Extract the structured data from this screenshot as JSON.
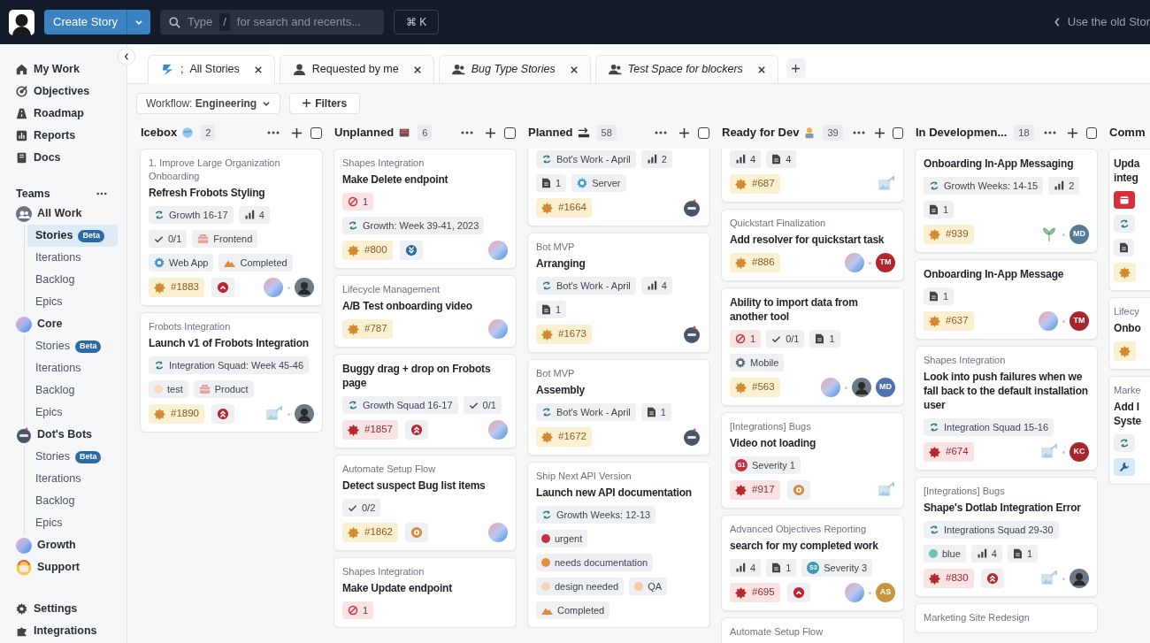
{
  "topbar": {
    "create_button": "Create Story",
    "search": {
      "placeholder_before": "Type",
      "key": "/",
      "placeholder_after": "for search and recents..."
    },
    "shortcut": "⌘ K",
    "old_view_link": "Use the old Stor"
  },
  "sidebar": {
    "nav": [
      {
        "label": "My Work"
      },
      {
        "label": "Objectives"
      },
      {
        "label": "Roadmap"
      },
      {
        "label": "Reports"
      },
      {
        "label": "Docs"
      }
    ],
    "teams_heading": "Teams",
    "teams": [
      {
        "label": "All Work",
        "children": [
          {
            "label": "Stories",
            "badge": "Beta",
            "selected": true
          },
          {
            "label": "Iterations",
            "selected": false
          },
          {
            "label": "Backlog",
            "selected": false
          },
          {
            "label": "Epics",
            "selected": false
          }
        ]
      },
      {
        "label": "Core",
        "children": [
          {
            "label": "Stories",
            "badge": "Beta",
            "selected": false
          },
          {
            "label": "Iterations",
            "selected": false
          },
          {
            "label": "Backlog",
            "selected": false
          },
          {
            "label": "Epics",
            "selected": false
          }
        ]
      },
      {
        "label": "Dot's Bots",
        "children": [
          {
            "label": "Stories",
            "badge": "Beta",
            "selected": false
          },
          {
            "label": "Iterations",
            "selected": false
          },
          {
            "label": "Backlog",
            "selected": false
          },
          {
            "label": "Epics",
            "selected": false
          }
        ]
      },
      {
        "label": "Growth"
      },
      {
        "label": "Support"
      }
    ],
    "footer": [
      {
        "label": "Settings"
      },
      {
        "label": "Integrations"
      }
    ]
  },
  "tabs": [
    {
      "prefix": ";",
      "label": "All Stories",
      "italic": false,
      "selected": true
    },
    {
      "label": "Requested by me",
      "italic": false,
      "selected": false
    },
    {
      "label": "Bug Type Stories",
      "italic": true,
      "selected": false
    },
    {
      "label": "Test Space for blockers",
      "italic": true,
      "selected": false
    }
  ],
  "filters": {
    "workflow": "Workflow: **Engineering**",
    "filters_button": "Filters"
  },
  "columns": [
    {
      "kind": "full",
      "title": "Icebox",
      "count": "2",
      "checked": false,
      "cards": [
        {
          "kind": "story",
          "epic": "1. Improve Large Organization Onboarding",
          "title": "Refresh Frobots Styling",
          "tag_rows": [
            {
              "tags": [
                {
                  "kind": "iteration",
                  "text": "Growth 16-17"
                },
                {
                  "kind": "estimate",
                  "text": "4"
                }
              ]
            },
            {
              "tags": [
                {
                  "kind": "tasks",
                  "text": "0/1"
                },
                {
                  "kind": "group",
                  "text": "Frontend"
                }
              ]
            },
            {
              "tags": [
                {
                  "kind": "area",
                  "text": "Web App",
                  "color": "#3b8fd6"
                },
                {
                  "kind": "skill",
                  "text": "Completed"
                }
              ]
            }
          ],
          "id": {
            "kind": "feature",
            "text": "#1883"
          },
          "priority": {
            "kind": "high"
          },
          "owners": [
            {
              "kind": "gradient"
            },
            {
              "kind": "person"
            }
          ]
        },
        {
          "kind": "story",
          "epic": "Frobots Integration",
          "title": "Launch v1 of Frobots Integration",
          "tag_rows": [
            {
              "tags": [
                {
                  "kind": "iteration",
                  "text": "Integration Squad: Week 45-46"
                }
              ]
            },
            {
              "tags": [
                {
                  "kind": "label",
                  "text": "test",
                  "color": "#f8d9bf"
                },
                {
                  "kind": "group",
                  "text": "Product"
                }
              ]
            }
          ],
          "id": {
            "kind": "feature",
            "text": "#1890"
          },
          "priority": {
            "kind": "highest"
          },
          "owners": [
            {
              "kind": "placeholder"
            },
            {
              "kind": "person"
            }
          ]
        }
      ]
    },
    {
      "kind": "full",
      "title": "Unplanned",
      "count": "6",
      "checked": false,
      "cards": [
        {
          "kind": "story",
          "epic": "Shapes Integration",
          "title": "Make Delete endpoint",
          "tag_rows": [
            {
              "tags": [
                {
                  "kind": "blocker",
                  "text": "1"
                }
              ]
            },
            {
              "tags": [
                {
                  "kind": "iteration",
                  "text": "Growth: Week 39-41, 2023"
                }
              ]
            }
          ],
          "id": {
            "kind": "feature",
            "text": "#800"
          },
          "priority": {
            "kind": "low"
          },
          "owners": [
            {
              "kind": "gradient"
            }
          ]
        },
        {
          "kind": "story",
          "epic": "Lifecycle Management",
          "title": "A/B Test onboarding video",
          "id": {
            "kind": "feature",
            "text": "#787"
          },
          "owners": [
            {
              "kind": "gradient"
            }
          ]
        },
        {
          "kind": "story",
          "title": "Buggy drag + drop on Frobots page",
          "tag_rows": [
            {
              "tags": [
                {
                  "kind": "iteration",
                  "text": "Growth Squad 16-17"
                },
                {
                  "kind": "tasks",
                  "text": "0/1"
                }
              ]
            }
          ],
          "id": {
            "kind": "bug",
            "text": "#1857"
          },
          "priority": {
            "kind": "highest"
          },
          "owners": [
            {
              "kind": "gradient"
            }
          ]
        },
        {
          "kind": "story",
          "epic": "Automate Setup Flow",
          "title": "Detect suspect Bug list items",
          "tag_rows": [
            {
              "tags": [
                {
                  "kind": "tasks",
                  "text": "0/2"
                }
              ]
            }
          ],
          "id": {
            "kind": "feature",
            "text": "#1862"
          },
          "priority": {
            "kind": "medium"
          },
          "owners": [
            {
              "kind": "gradient"
            }
          ]
        },
        {
          "kind": "story",
          "epic": "Shapes Integration",
          "title": "Make Update endpoint",
          "tag_rows": [
            {
              "tags": [
                {
                  "kind": "blocker",
                  "text": "1"
                }
              ]
            }
          ]
        }
      ]
    },
    {
      "kind": "full",
      "title": "Planned",
      "count": "58",
      "checked": false,
      "cards": [
        {
          "kind": "cut",
          "tag_rows": [
            {
              "tags": [
                {
                  "kind": "iteration",
                  "text": "Bot's Work - April"
                },
                {
                  "kind": "estimate",
                  "text": "2"
                }
              ]
            },
            {
              "tags": [
                {
                  "kind": "docs",
                  "text": "1"
                },
                {
                  "kind": "area",
                  "text": "Server",
                  "color": "#3b9fd6"
                }
              ]
            }
          ],
          "id": {
            "kind": "feature",
            "text": "#1664"
          },
          "owners": [
            {
              "kind": "bot"
            }
          ]
        },
        {
          "kind": "story",
          "epic": "Bot MVP",
          "title": "Arranging",
          "tag_rows": [
            {
              "tags": [
                {
                  "kind": "iteration",
                  "text": "Bot's Work - April"
                },
                {
                  "kind": "estimate",
                  "text": "4"
                }
              ]
            },
            {
              "tags": [
                {
                  "kind": "docs",
                  "text": "1"
                }
              ]
            }
          ],
          "id": {
            "kind": "feature",
            "text": "#1673"
          },
          "owners": [
            {
              "kind": "bot"
            }
          ]
        },
        {
          "kind": "story",
          "epic": "Bot MVP",
          "title": "Assembly",
          "tag_rows": [
            {
              "tags": [
                {
                  "kind": "iteration",
                  "text": "Bot's Work - April"
                },
                {
                  "kind": "docs",
                  "text": "1"
                }
              ]
            }
          ],
          "id": {
            "kind": "feature",
            "text": "#1672"
          },
          "owners": [
            {
              "kind": "bot"
            }
          ]
        },
        {
          "kind": "story",
          "epic": "Ship Next API Version",
          "title": "Launch new API documentation",
          "tag_rows": [
            {
              "tags": [
                {
                  "kind": "iteration",
                  "text": "Growth Weeks: 12-13"
                }
              ]
            },
            {
              "tags": [
                {
                  "kind": "label",
                  "text": "urgent",
                  "color": "#c0323f"
                }
              ]
            },
            {
              "tags": [
                {
                  "kind": "label",
                  "text": "needs documentation",
                  "color": "#e3913f"
                }
              ]
            },
            {
              "tags": [
                {
                  "kind": "label",
                  "text": "design needed",
                  "color": "#f6d3b0"
                },
                {
                  "kind": "label",
                  "text": "QA",
                  "color": "#f6c9a2"
                }
              ]
            },
            {
              "tags": [
                {
                  "kind": "skill",
                  "text": "Completed"
                }
              ]
            }
          ]
        }
      ]
    },
    {
      "kind": "full",
      "title": "Ready for Dev",
      "count": "39",
      "checked": false,
      "cards": [
        {
          "kind": "cut",
          "tag_rows": [
            {
              "tags": [
                {
                  "kind": "estimate",
                  "text": "4"
                },
                {
                  "kind": "docs",
                  "text": "4"
                }
              ]
            }
          ],
          "id": {
            "kind": "feature",
            "text": "#687"
          },
          "owners": [
            {
              "kind": "placeholder"
            }
          ]
        },
        {
          "kind": "story",
          "epic": "Quickstart Finalization",
          "title": "Add resolver for quickstart task",
          "id": {
            "kind": "feature",
            "text": "#886"
          },
          "owners": [
            {
              "kind": "gradient"
            },
            {
              "kind": "initials",
              "text": "TM",
              "color": "#b3262e"
            }
          ]
        },
        {
          "kind": "story",
          "title": "Ability to import data from another tool",
          "tag_rows": [
            {
              "tags": [
                {
                  "kind": "blocker",
                  "text": "1"
                },
                {
                  "kind": "tasks",
                  "text": "0/1"
                },
                {
                  "kind": "docs",
                  "text": "1"
                }
              ]
            },
            {
              "tags": [
                {
                  "kind": "area",
                  "text": "Mobile",
                  "color": "#5a6b7b"
                }
              ]
            }
          ],
          "id": {
            "kind": "feature",
            "text": "#563"
          },
          "owners": [
            {
              "kind": "gradient"
            },
            {
              "kind": "person"
            },
            {
              "kind": "initials",
              "text": "MD",
              "color": "#4f72ad"
            }
          ]
        },
        {
          "kind": "story",
          "epic": "[Integrations] Bugs",
          "title": "Video not loading",
          "tag_rows": [
            {
              "tags": [
                {
                  "kind": "severity",
                  "badge": "S1",
                  "text": "Severity 1",
                  "color": "#c0323f"
                }
              ]
            }
          ],
          "id": {
            "kind": "bug",
            "text": "#917"
          },
          "priority": {
            "kind": "medium"
          },
          "owners": [
            {
              "kind": "placeholder"
            }
          ]
        },
        {
          "kind": "story",
          "epic": "Advanced Objectives Reporting",
          "title": "search for my completed work",
          "tag_rows": [
            {
              "tags": [
                {
                  "kind": "estimate",
                  "text": "4"
                },
                {
                  "kind": "docs",
                  "text": "1"
                },
                {
                  "kind": "severity",
                  "badge": "S3",
                  "text": "Severity 3",
                  "color": "#3a9bb5"
                }
              ]
            }
          ],
          "id": {
            "kind": "bug",
            "text": "#695"
          },
          "priority": {
            "kind": "high"
          },
          "owners": [
            {
              "kind": "gradient"
            },
            {
              "kind": "initials",
              "text": "AS",
              "color": "#c9953f"
            }
          ]
        },
        {
          "kind": "story",
          "epic": "Automate Setup Flow"
        }
      ]
    },
    {
      "kind": "full",
      "title": "In Developmen...",
      "count": "18",
      "checked": false,
      "cards": [
        {
          "kind": "story",
          "title": "Onboarding In-App Messaging",
          "tag_rows": [
            {
              "tags": [
                {
                  "kind": "iteration",
                  "text": "Growth Weeks: 14-15"
                },
                {
                  "kind": "estimate",
                  "text": "2"
                }
              ]
            },
            {
              "tags": [
                {
                  "kind": "docs",
                  "text": "1"
                }
              ]
            }
          ],
          "id": {
            "kind": "feature",
            "text": "#939"
          },
          "owners": [
            {
              "kind": "plant"
            },
            {
              "kind": "initials",
              "text": "MD",
              "color": "#557a95"
            }
          ]
        },
        {
          "kind": "story",
          "title": "Onboarding In-App Message",
          "tag_rows": [
            {
              "tags": [
                {
                  "kind": "docs",
                  "text": "1"
                }
              ]
            }
          ],
          "id": {
            "kind": "feature",
            "text": "#637"
          },
          "owners": [
            {
              "kind": "gradient"
            },
            {
              "kind": "initials",
              "text": "TM",
              "color": "#a8262b"
            }
          ]
        },
        {
          "kind": "story",
          "epic": "Shapes Integration",
          "title": "Look into push failures when we fall back to the default installation user",
          "tag_rows": [
            {
              "tags": [
                {
                  "kind": "iteration",
                  "text": "Integration Squad 15-16"
                }
              ]
            }
          ],
          "id": {
            "kind": "bug",
            "text": "#674"
          },
          "owners": [
            {
              "kind": "placeholder"
            },
            {
              "kind": "initials",
              "text": "KC",
              "color": "#a8262b"
            }
          ]
        },
        {
          "kind": "story",
          "epic": "[Integrations] Bugs",
          "title": "Shape's Dotlab Integration Error",
          "tag_rows": [
            {
              "tags": [
                {
                  "kind": "iteration",
                  "text": "Integrations Squad 29-30"
                }
              ]
            },
            {
              "tags": [
                {
                  "kind": "label",
                  "text": "blue",
                  "color": "#6fc2b4"
                },
                {
                  "kind": "estimate",
                  "text": "4"
                },
                {
                  "kind": "docs",
                  "text": "1"
                }
              ]
            }
          ],
          "id": {
            "kind": "bug",
            "text": "#830"
          },
          "priority": {
            "kind": "highest"
          },
          "owners": [
            {
              "kind": "placeholder"
            },
            {
              "kind": "person"
            }
          ]
        },
        {
          "kind": "story",
          "epic": "Marketing Site Redesign"
        }
      ]
    },
    {
      "kind": "partial",
      "title": "Comm",
      "cards": [
        {
          "kind": "story",
          "title": "Upda integ",
          "tag_rows": [
            {
              "tags": [
                {
                  "kind": "deadline"
                }
              ]
            },
            {
              "tags": [
                {
                  "kind": "iteration"
                }
              ]
            },
            {
              "tags": [
                {
                  "kind": "docs"
                }
              ]
            }
          ],
          "id": {
            "kind": "feature"
          }
        },
        {
          "kind": "story",
          "epic": "Lifecy",
          "title": "Onbo",
          "id": {
            "kind": "feature"
          }
        },
        {
          "kind": "story",
          "epic": "Marke",
          "title": "Add I Syste",
          "tag_rows": [
            {
              "tags": [
                {
                  "kind": "iteration"
                }
              ]
            },
            {
              "tags": [
                {
                  "kind": "integration"
                }
              ]
            }
          ]
        }
      ]
    }
  ]
}
